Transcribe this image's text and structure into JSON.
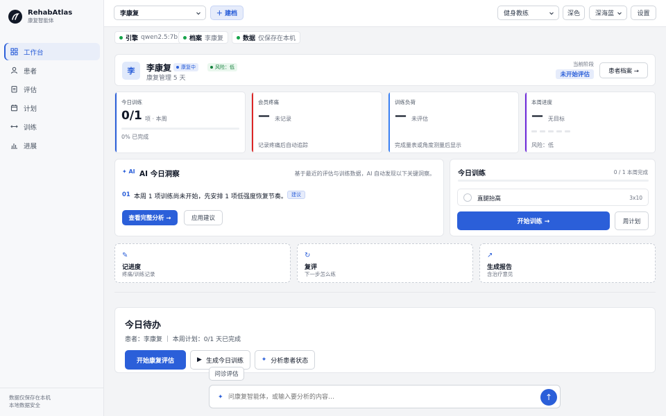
{
  "brand": {
    "name": "RehabAtlas",
    "subtitle": "康复智能体"
  },
  "nav": [
    {
      "label": "工作台",
      "icon": "grid-icon",
      "active": true
    },
    {
      "label": "患者",
      "icon": "user-icon",
      "active": false
    },
    {
      "label": "评估",
      "icon": "clipboard-icon",
      "active": false
    },
    {
      "label": "计划",
      "icon": "calendar-icon",
      "active": false
    },
    {
      "label": "训练",
      "icon": "arrows-icon",
      "active": false
    },
    {
      "label": "进展",
      "icon": "bar-chart-icon",
      "active": false
    }
  ],
  "sidebar_footer": [
    "数据仅保存在本机",
    "本地数据安全"
  ],
  "topbar": {
    "patient_select": "李康复",
    "build_button": "＋ 建档",
    "role_select": "健身教练",
    "dark_button": "深色",
    "theme_select": "深海蓝",
    "settings_button": "设置"
  },
  "chips": [
    {
      "key": "引擎",
      "value": "qwen2.5:7b"
    },
    {
      "key": "档案",
      "value": "李康复"
    },
    {
      "key": "数据",
      "value": "仅保存在本机"
    }
  ],
  "patient": {
    "avatar": "李",
    "name": "李康复",
    "sub": "康复管理 5 天",
    "status_tag": "康复中",
    "risk_tag": "风险：低",
    "stage_label": "当前阶段",
    "stage_value": "未开始评估",
    "profile_button": "患者档案 →"
  },
  "stats": [
    {
      "label": "今日训练",
      "big": "0/1",
      "unit": "项 · 本周",
      "foot": "0% 已完成",
      "progress": 0,
      "color": "#2b5fd9"
    },
    {
      "label": "会员疼痛",
      "big": "—",
      "unit": "未记录",
      "foot": "记录疼痛后自动追踪",
      "color": "#dc2626"
    },
    {
      "label": "训练负荷",
      "big": "—",
      "unit": "未评估",
      "foot": "完成量表或角度测量后显示",
      "color": "#3b82f6"
    },
    {
      "label": "本周进度",
      "big": "—",
      "unit": "无目标",
      "foot": "风险：低",
      "color": "#6d28d9"
    }
  ],
  "insight": {
    "badge": "✦ AI",
    "title": "AI 今日洞察",
    "desc": "基于最近的评估与训练数据，AI 自动发现以下关键洞察。",
    "item_num": "01",
    "item_text": "本周 1 项训练尚未开始，先安排 1 项低强度恢复节奏。",
    "item_tag": "建议",
    "primary_button": "查看完整分析 →",
    "secondary_button": "应用建议"
  },
  "today_training": {
    "title": "今日训练",
    "count": "0 / 1 本周完成",
    "progress": 0,
    "exercise_name": "直腿抬高",
    "exercise_sets": "3x10",
    "start_button": "开始训练 →",
    "week_plan_button": "周计划"
  },
  "quick_actions": [
    {
      "icon": "pencil-icon",
      "glyph": "✎",
      "title": "记进度",
      "sub": "疼痛/训练记录"
    },
    {
      "icon": "refresh-icon",
      "glyph": "↻",
      "title": "复评",
      "sub": "下一步怎么练"
    },
    {
      "icon": "arrow-up-right-icon",
      "glyph": "↗",
      "title": "生成报告",
      "sub": "含治疗意见"
    }
  ],
  "todo": {
    "title": "今日待办",
    "meta": "患者：李康复 ｜ 本周计划：0/1 天已完成",
    "primary": "开始康复评估",
    "action1": "生成今日训练",
    "action2": "分析患者状态"
  },
  "composer": {
    "chip": "问诊评估",
    "placeholder": "问康复智能体，或输入要分析的内容…",
    "send": "↑"
  },
  "colors": {
    "accent": "#2b5fd9",
    "ok": "#16a34a",
    "danger": "#dc2626"
  }
}
